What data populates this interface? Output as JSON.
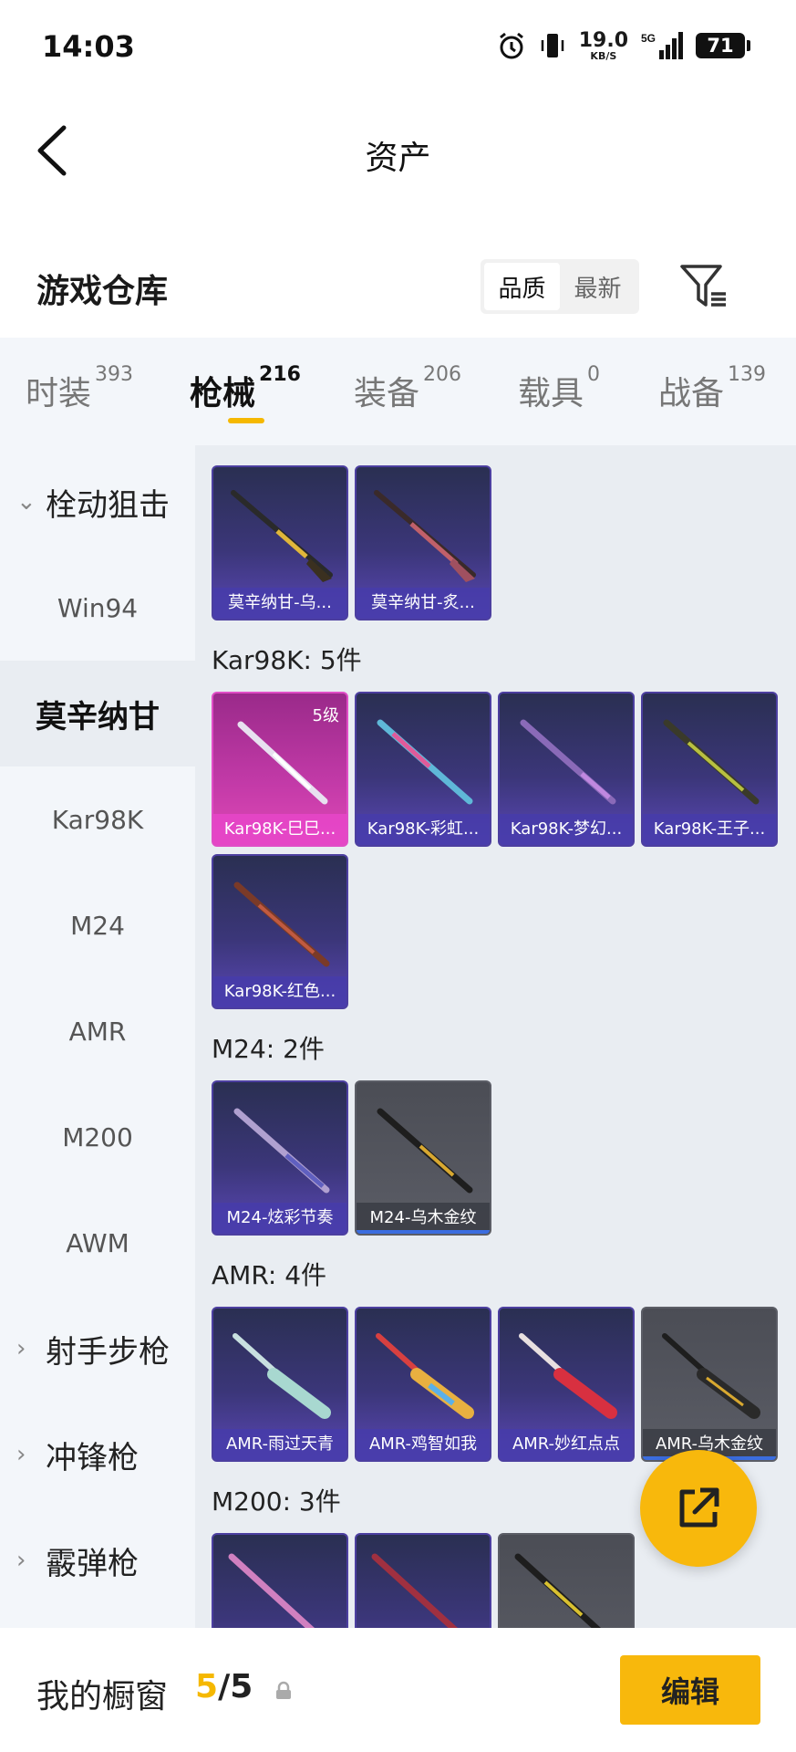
{
  "status_bar": {
    "time": "14:03",
    "net_speed_value": "19.0",
    "net_speed_unit": "KB/S",
    "signal_label": "5G",
    "battery": "71"
  },
  "header": {
    "title": "资产"
  },
  "section": {
    "title": "游戏仓库",
    "sort_options": [
      "品质",
      "最新"
    ],
    "active_sort": "品质"
  },
  "tabs": [
    {
      "label": "时装",
      "count": "393"
    },
    {
      "label": "枪械",
      "count": "216"
    },
    {
      "label": "装备",
      "count": "206"
    },
    {
      "label": "载具",
      "count": "0"
    },
    {
      "label": "战备",
      "count": "139"
    }
  ],
  "active_tab": "枪械",
  "sidebar": {
    "items": [
      {
        "label": "栓动狙击",
        "type": "group",
        "expanded": true
      },
      {
        "label": "Win94",
        "type": "item"
      },
      {
        "label": "莫辛纳甘",
        "type": "item",
        "active": true
      },
      {
        "label": "Kar98K",
        "type": "item"
      },
      {
        "label": "M24",
        "type": "item"
      },
      {
        "label": "AMR",
        "type": "item"
      },
      {
        "label": "M200",
        "type": "item"
      },
      {
        "label": "AWM",
        "type": "item"
      },
      {
        "label": "射手步枪",
        "type": "group",
        "expanded": false
      },
      {
        "label": "冲锋枪",
        "type": "group",
        "expanded": false
      },
      {
        "label": "霰弹枪",
        "type": "group",
        "expanded": false
      }
    ]
  },
  "groups": [
    {
      "label": "",
      "items": [
        {
          "name": "莫辛纳甘-乌...",
          "style": "purple"
        },
        {
          "name": "莫辛纳甘-炙...",
          "style": "purple"
        }
      ]
    },
    {
      "label": "Kar98K: 5件",
      "items": [
        {
          "name": "Kar98K-巳巳...",
          "style": "pink",
          "level": "5级"
        },
        {
          "name": "Kar98K-彩虹...",
          "style": "purple"
        },
        {
          "name": "Kar98K-梦幻...",
          "style": "purple"
        },
        {
          "name": "Kar98K-王子...",
          "style": "purple"
        },
        {
          "name": "Kar98K-红色...",
          "style": "purple"
        }
      ]
    },
    {
      "label": "M24: 2件",
      "items": [
        {
          "name": "M24-炫彩节奏",
          "style": "purple"
        },
        {
          "name": "M24-乌木金纹",
          "style": "gray"
        }
      ]
    },
    {
      "label": "AMR: 4件",
      "items": [
        {
          "name": "AMR-雨过天青",
          "style": "purple"
        },
        {
          "name": "AMR-鸡智如我",
          "style": "purple"
        },
        {
          "name": "AMR-妙红点点",
          "style": "purple"
        },
        {
          "name": "AMR-乌木金纹",
          "style": "gray"
        }
      ]
    },
    {
      "label": "M200: 3件",
      "items": [
        {
          "name": "",
          "style": "purple"
        },
        {
          "name": "",
          "style": "purple"
        },
        {
          "name": "",
          "style": "gray"
        }
      ]
    }
  ],
  "bottom_bar": {
    "label": "我的橱窗",
    "current": "5",
    "separator": "/",
    "total": "5",
    "edit_label": "编辑"
  },
  "colors": {
    "accent": "#f8b80c",
    "sidebar_bg": "#f3f6fa",
    "content_bg": "#e9edf2"
  },
  "icons": [
    "back-arrow-icon",
    "filter-icon",
    "share-icon",
    "lock-icon",
    "chevron-down-icon",
    "chevron-right-icon",
    "alarm-icon",
    "vibrate-icon",
    "signal-icon"
  ]
}
